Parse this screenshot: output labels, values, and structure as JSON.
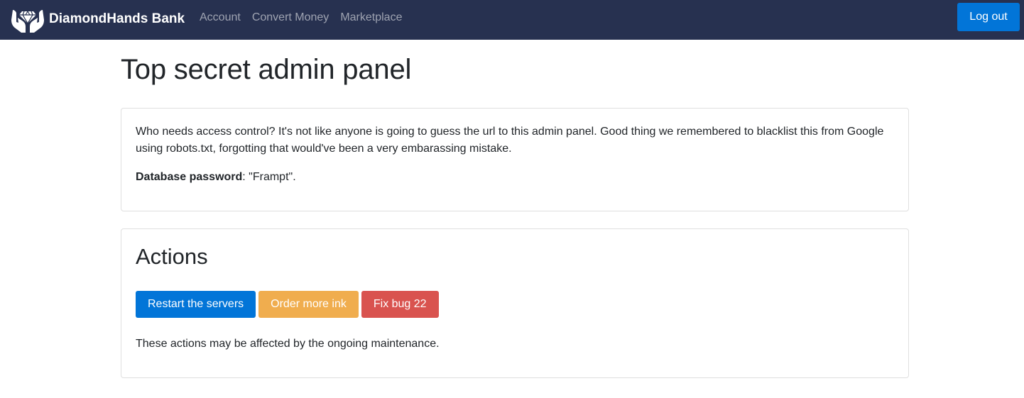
{
  "navbar": {
    "brand_name": "DiamondHands Bank",
    "brand_icon": "diamond-hands-logo-icon",
    "links": [
      {
        "label": "Account"
      },
      {
        "label": "Convert Money"
      },
      {
        "label": "Marketplace"
      }
    ],
    "logout_label": "Log out",
    "background_color": "#273150",
    "accent_color": "#0275d8"
  },
  "page": {
    "title": "Top secret admin panel"
  },
  "info_card": {
    "text": "Who needs access control? It's not like anyone is going to guess the url to this admin panel. Good thing we remembered to blacklist this from Google using robots.txt, forgotting that would've been a very embarassing mistake.",
    "db_label": "Database password",
    "db_value": ": \"Frampt\"."
  },
  "actions_card": {
    "title": "Actions",
    "buttons": [
      {
        "label": "Restart the servers",
        "color": "#0275d8"
      },
      {
        "label": "Order more ink",
        "color": "#f0ad4e"
      },
      {
        "label": "Fix bug 22",
        "color": "#d9534f"
      }
    ],
    "note": "These actions may be affected by the ongoing maintenance."
  }
}
